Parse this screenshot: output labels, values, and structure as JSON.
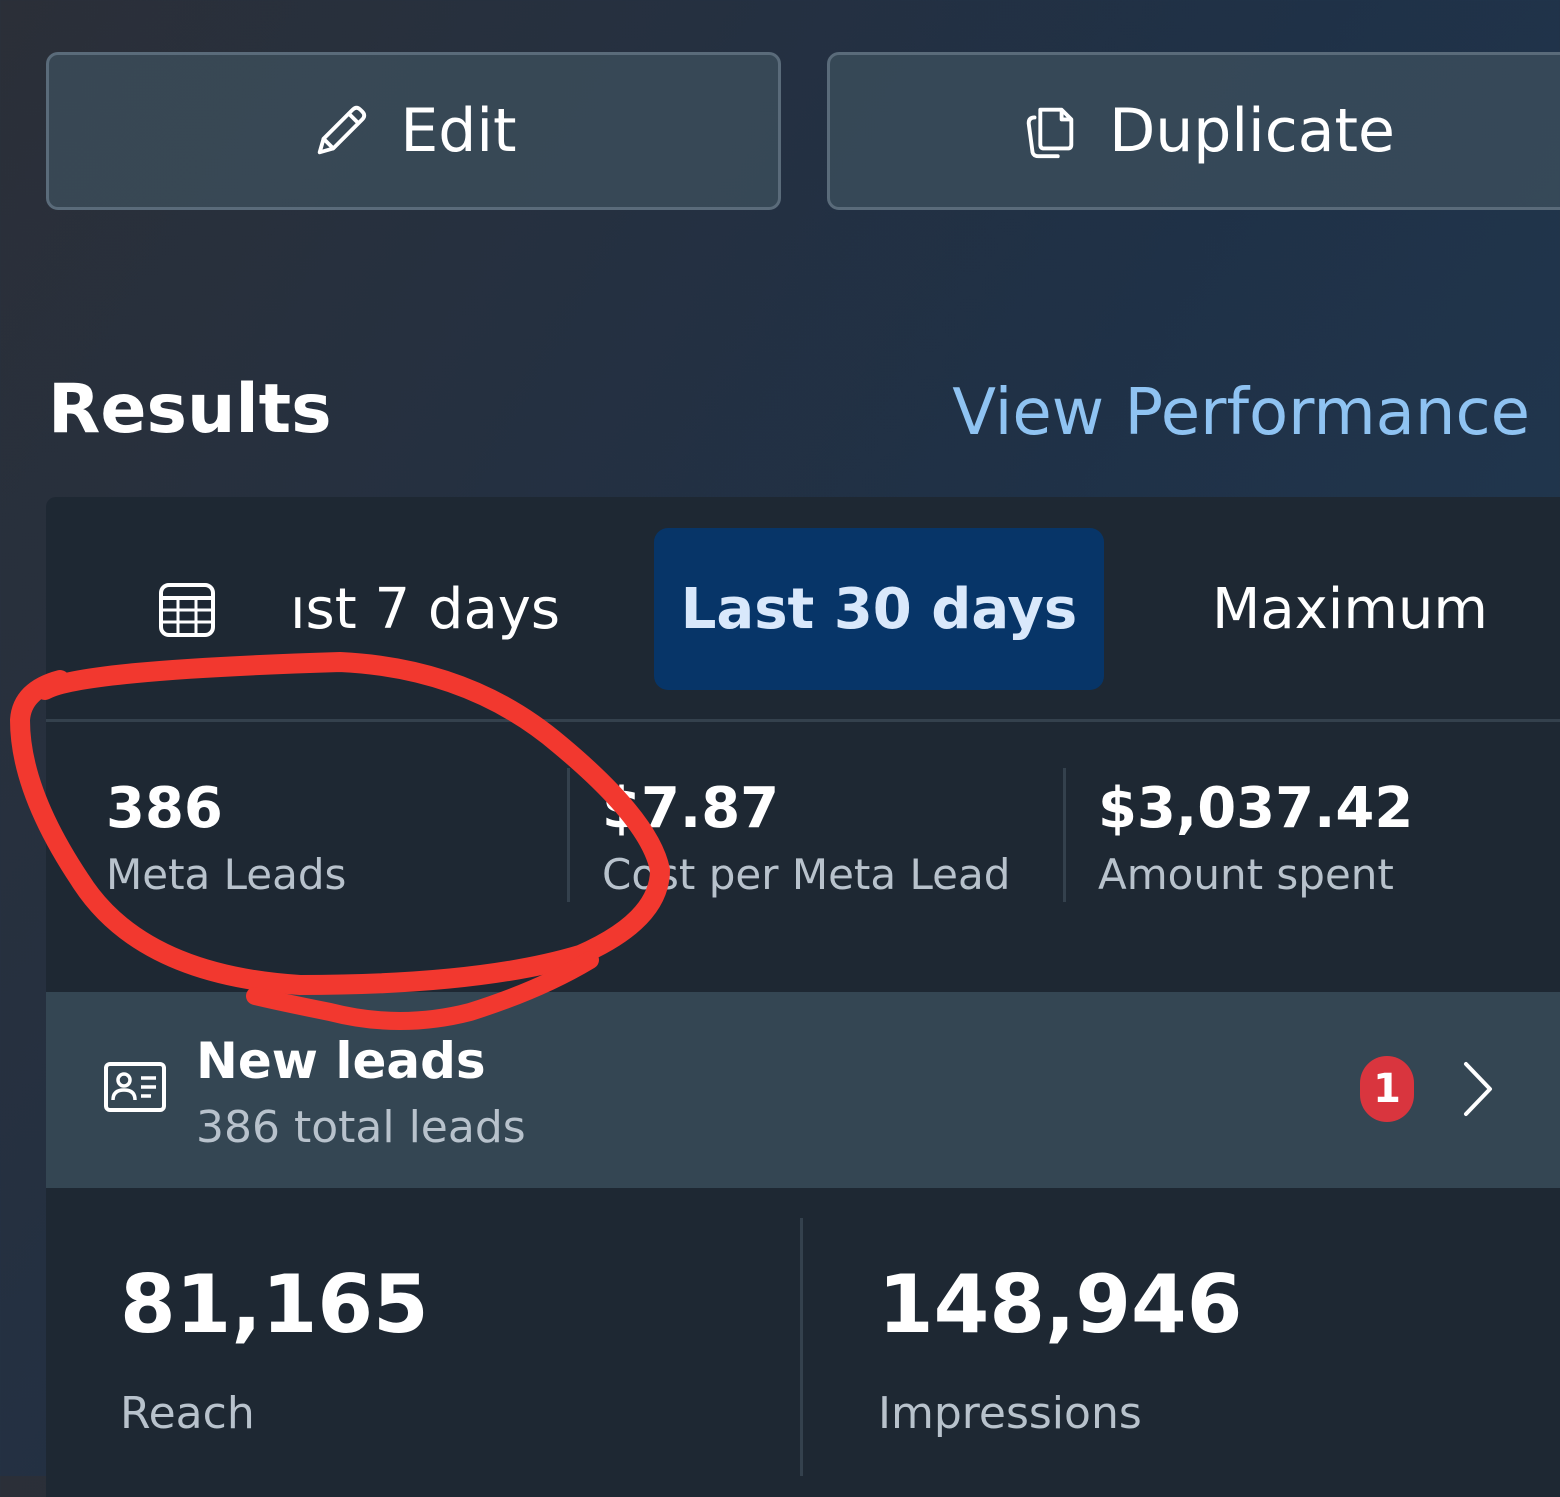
{
  "toolbar": {
    "edit_label": "Edit",
    "duplicate_label": "Duplicate"
  },
  "results": {
    "title": "Results",
    "view_performance": "View Performance"
  },
  "date_tabs": [
    {
      "label": "ıst 7 days",
      "selected": false
    },
    {
      "label": "Last 30 days",
      "selected": true
    },
    {
      "label": "Maximum",
      "selected": false
    }
  ],
  "metrics": [
    {
      "value": "386",
      "label": "Meta Leads"
    },
    {
      "value": "$7.87",
      "label": "Cost per Meta Lead"
    },
    {
      "value": "$3,037.42",
      "label": "Amount spent"
    }
  ],
  "new_leads": {
    "title": "New leads",
    "subtitle": "386 total leads",
    "badge": "1"
  },
  "stats": [
    {
      "value": "81,165",
      "label": "Reach"
    },
    {
      "value": "148,946",
      "label": "Impressions"
    }
  ],
  "colors": {
    "accent_link": "#8fc3f2",
    "selected_tab_bg": "#073568",
    "badge_red": "#d9353e",
    "annotation_red": "#f2382f"
  },
  "icons": {
    "edit": "pencil-icon",
    "duplicate": "copy-icon",
    "calendar": "calendar-icon",
    "leads": "contact-card-icon",
    "chevron": "chevron-right-icon"
  }
}
